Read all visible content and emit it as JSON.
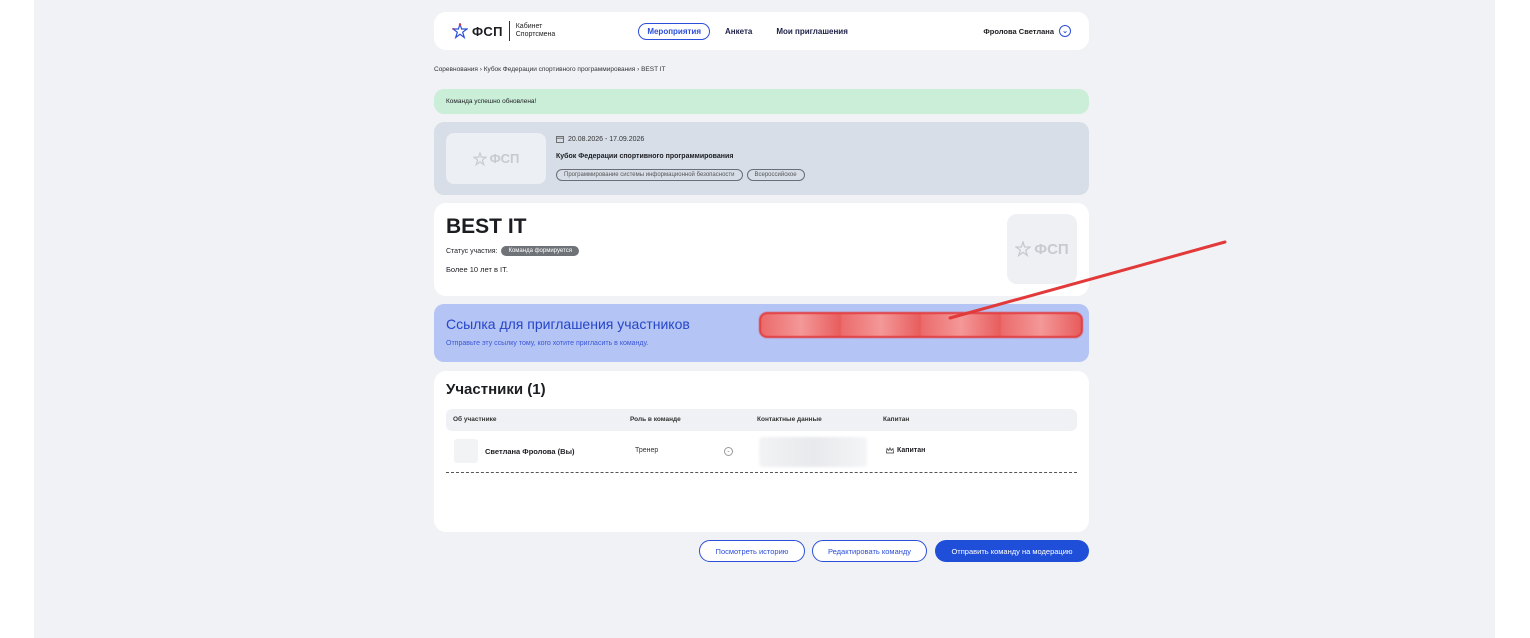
{
  "header": {
    "logo_text": "ФСП",
    "logo_sub_line1": "Кабинет",
    "logo_sub_line2": "Спортсмена",
    "nav": [
      "Мероприятия",
      "Анкета",
      "Мои приглашения"
    ],
    "user_name": "Фролова Светлана"
  },
  "breadcrumb": "Соревнования  ›  Кубок Федерации спортивного программирования  ›  BEST IT",
  "alert": "Команда успешно обновлена!",
  "event": {
    "logo_text": "ФСП",
    "dates": "20.08.2026 - 17.09.2026",
    "title": "Кубок Федерации спортивного программирования",
    "tags": [
      "Программирование системы информационной безопасности",
      "Всероссийское"
    ]
  },
  "team": {
    "name": "BEST IT",
    "status_label": "Статус участия:",
    "status_badge": "Команда формируется",
    "description": "Более 10 лет в IT.",
    "logo_text": "ФСП"
  },
  "invite": {
    "title": "Ссылка для приглашения участников",
    "subtitle": "Отправьте эту ссылку тому, кого хотите пригласить в команду."
  },
  "members": {
    "title": "Участники (1)",
    "columns": [
      "Об участнике",
      "Роль в команде",
      "Контактные данные",
      "Капитан"
    ],
    "rows": [
      {
        "name": "Светлана Фролова (Вы)",
        "role": "Тренер",
        "captain": "Капитан"
      }
    ]
  },
  "actions": {
    "history": "Посмотреть историю",
    "edit": "Редактировать команду",
    "submit": "Отправить команду на модерацию"
  },
  "colors": {
    "accent": "#2b4ed8",
    "success_bg": "#cbeed9",
    "invite_bg": "#b4c4f5",
    "annotation": "#e23a3a"
  }
}
